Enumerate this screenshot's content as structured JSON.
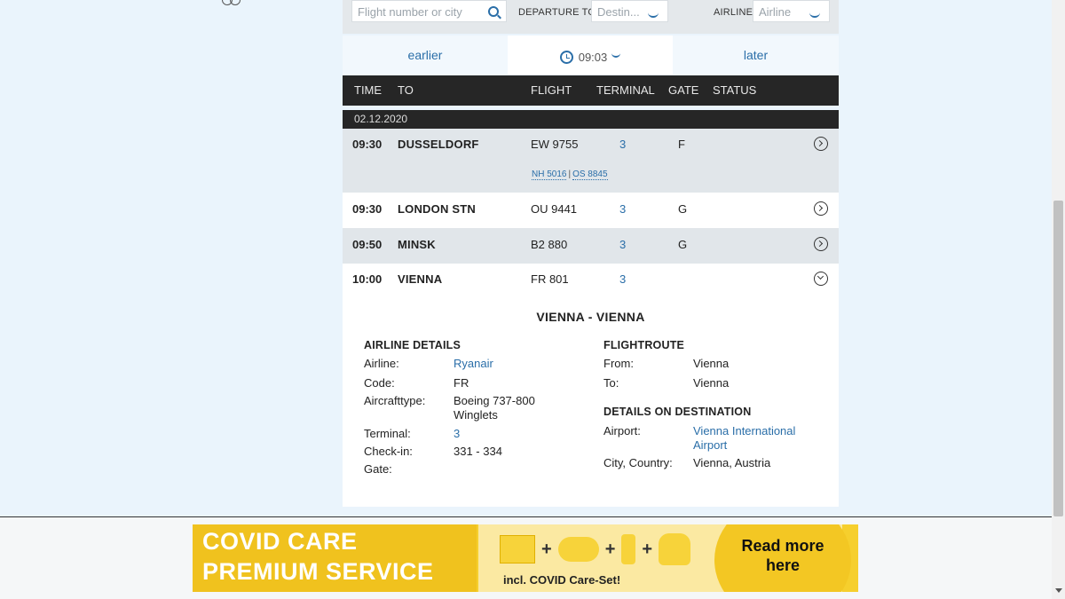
{
  "search": {
    "placeholder": "Flight number or city"
  },
  "filters": {
    "departure_label": "DEPARTURE TO",
    "destination_placeholder": "Destin...",
    "airline_label": "AIRLINE",
    "airline_placeholder": "Airline"
  },
  "timenav": {
    "earlier": "earlier",
    "current_time": "09:03",
    "later": "later"
  },
  "table": {
    "headers": [
      "TIME",
      "TO",
      "FLIGHT",
      "TERMINAL",
      "GATE",
      "STATUS"
    ],
    "date": "02.12.2020",
    "rows": [
      {
        "time": "09:30",
        "to": "DUSSELDORF",
        "flight": "EW 9755",
        "terminal": "3",
        "gate": "F",
        "codeshares": [
          "NH 5016",
          "OS 8845"
        ],
        "codeshare_sep": "|"
      },
      {
        "time": "09:30",
        "to": "LONDON STN",
        "flight": "OU 9441",
        "terminal": "3",
        "gate": "G"
      },
      {
        "time": "09:50",
        "to": "MINSK",
        "flight": "B2 880",
        "terminal": "3",
        "gate": "G"
      },
      {
        "time": "10:00",
        "to": "VIENNA",
        "flight": "FR 801",
        "terminal": "3",
        "gate": ""
      }
    ]
  },
  "details": {
    "title": "VIENNA - VIENNA",
    "airline_section": "AIRLINE DETAILS",
    "airline_label": "Airline:",
    "airline": "Ryanair",
    "code_label": "Code:",
    "code": "FR",
    "aircraft_label": "Aircrafttype:",
    "aircraft_line1": "Boeing 737-800",
    "aircraft_line2": "Winglets",
    "terminal_label": "Terminal:",
    "terminal": "3",
    "checkin_label": "Check-in:",
    "checkin": "331 - 334",
    "gate_label": "Gate:",
    "route_section": "FLIGHTROUTE",
    "from_label": "From:",
    "from": "Vienna",
    "to_label": "To:",
    "to": "Vienna",
    "dest_section": "DETAILS ON DESTINATION",
    "airport_label": "Airport:",
    "airport_line1": "Vienna International",
    "airport_line2": "Airport",
    "city_label": "City, Country:",
    "city": "Vienna, Austria"
  },
  "banner": {
    "line1": "COVID CARE",
    "line2": "PREMIUM SERVICE",
    "plus": "+",
    "incl": "incl. COVID Care-Set!",
    "cta_line1": "Read more",
    "cta_line2": "here"
  },
  "colors": {
    "accent": "#2a6ea8",
    "header_bg": "#262626",
    "banner_yellow": "#f6cf2d"
  }
}
